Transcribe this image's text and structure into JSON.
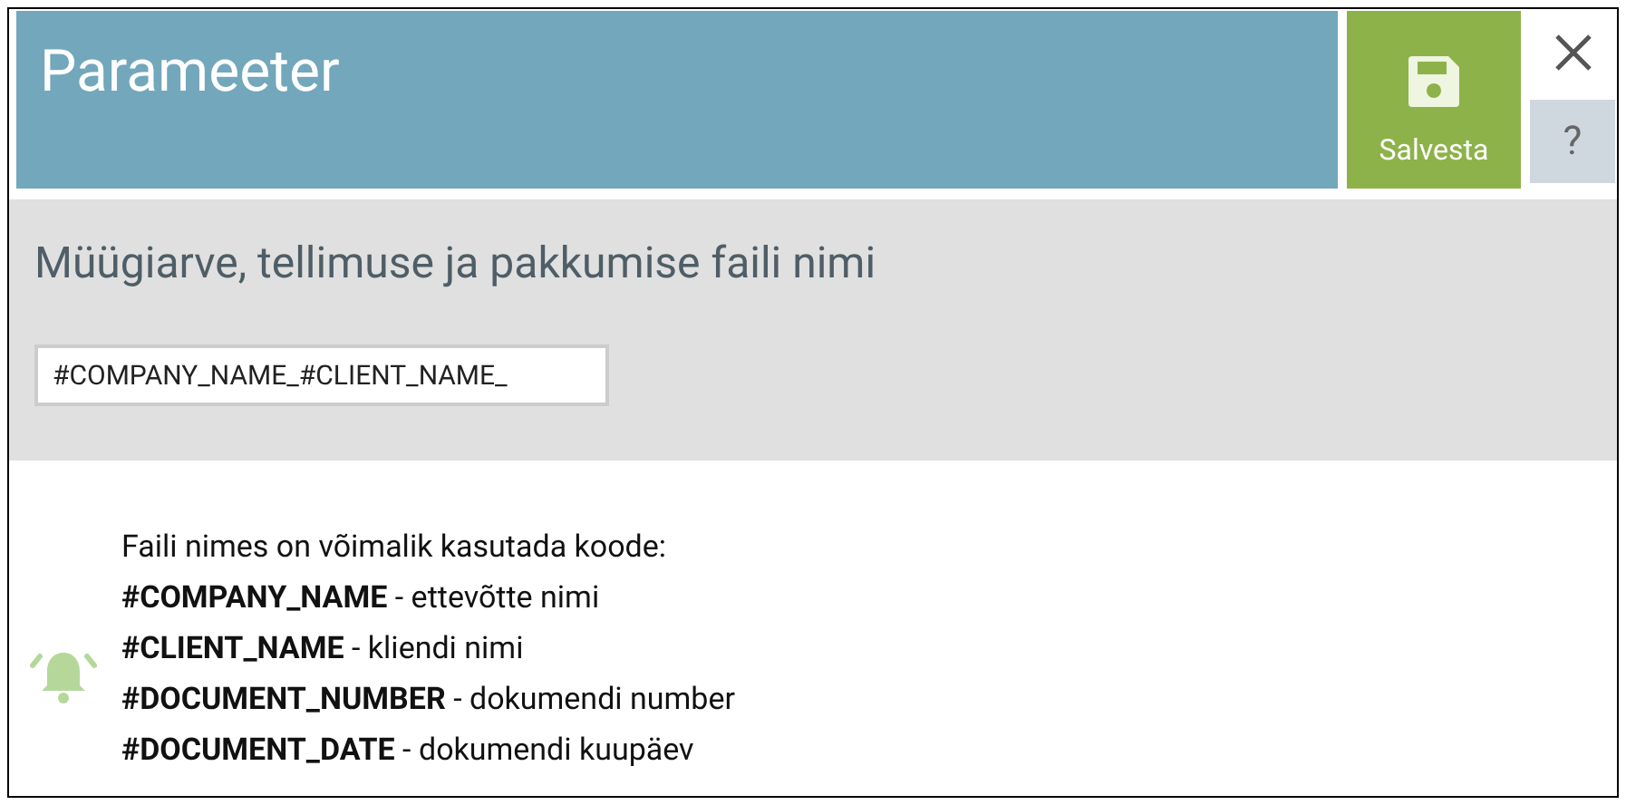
{
  "header": {
    "title": "Parameeter",
    "save_label": "Salvesta",
    "help_label": "?"
  },
  "parameter": {
    "label": "Müügiarve, tellimuse ja pakkumise faili nimi",
    "value": "#COMPANY_NAME_#CLIENT_NAME_"
  },
  "info": {
    "intro": "Faili nimes on võimalik kasutada koode:",
    "lines": [
      "**#COMPANY_NAME** - ettevõtte nimi",
      "**#CLIENT_NAME** - kliendi nimi",
      "**#DOCUMENT_NUMBER** - dokumendi number",
      "**#DOCUMENT_DATE** - dokumendi kuupäev"
    ]
  }
}
